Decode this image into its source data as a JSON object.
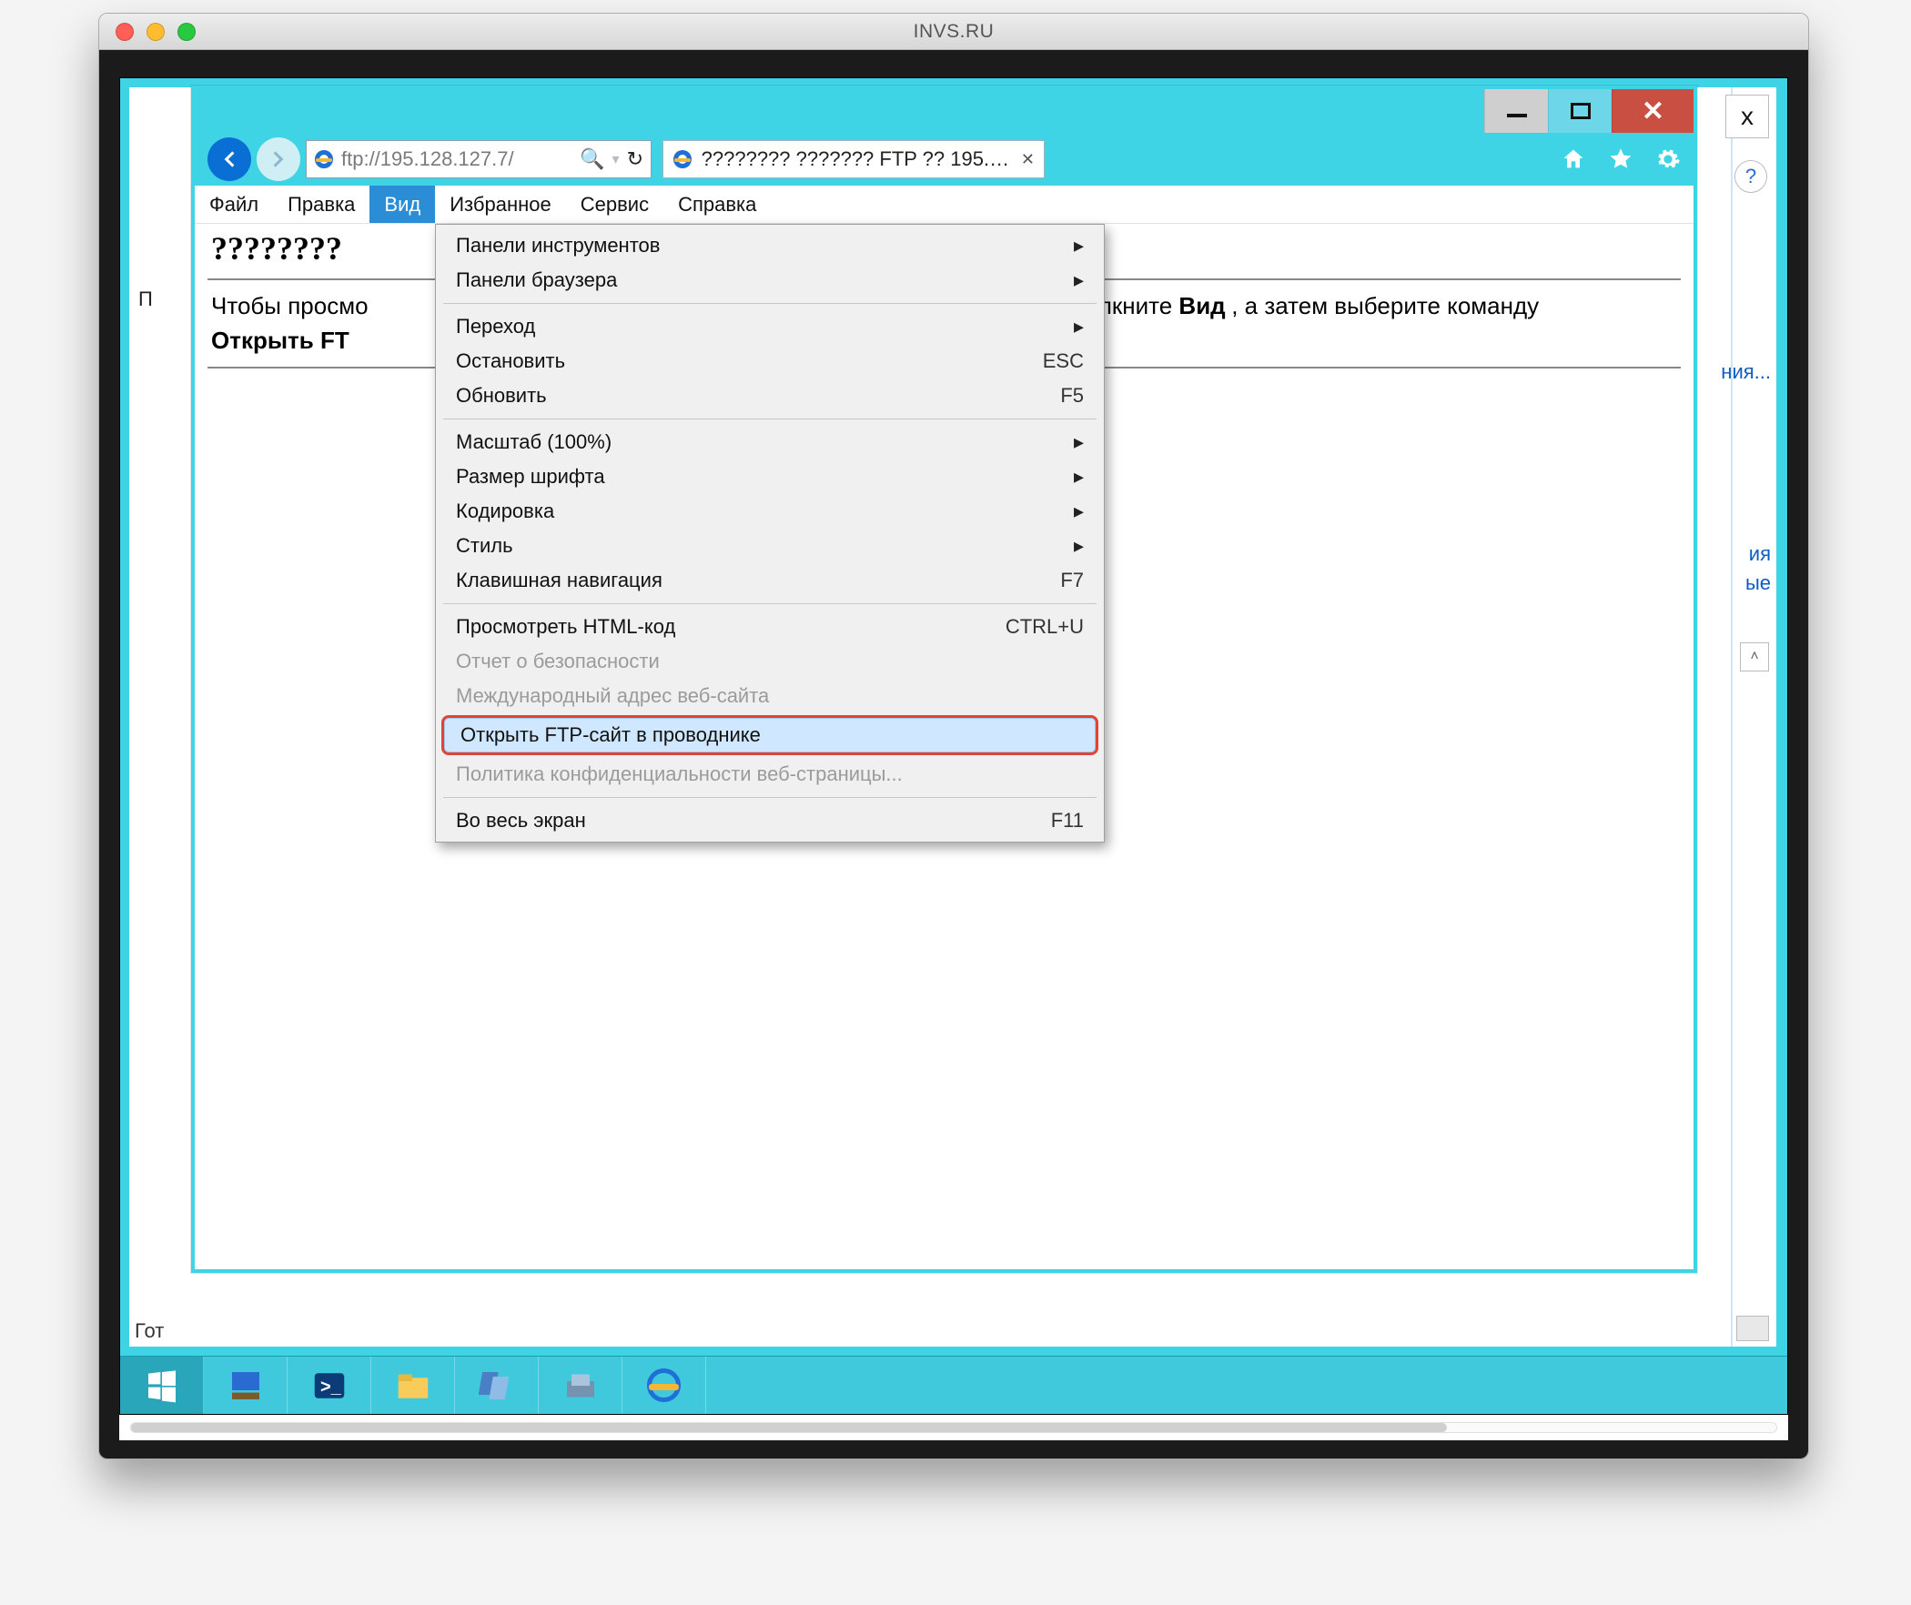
{
  "mac": {
    "title": "INVS.RU"
  },
  "bg": {
    "close_x": "x",
    "help": "?",
    "link1": "ния...",
    "link2": "ия",
    "link3": "ые",
    "status": "Гот",
    "left_label1": "П",
    "left_label2": ""
  },
  "ie": {
    "url": "ftp://195.128.127.7/",
    "tab_title": "???????? ??????? FTP ?? 195.1...",
    "menubar": [
      "Файл",
      "Правка",
      "Вид",
      "Избранное",
      "Сервис",
      "Справка"
    ],
    "active_menu_index": 2,
    "page": {
      "heading": "????????",
      "line1_pre": "Чтобы просмо",
      "line1_post": ", щелкните ",
      "line1_bold": "Вид",
      "line1_tail": ", а затем выберите команду",
      "line2_bold": "Открыть FT"
    }
  },
  "menu": {
    "items": [
      {
        "label": "Панели инструментов",
        "submenu": true
      },
      {
        "label": "Панели браузера",
        "submenu": true
      },
      {
        "sep": true
      },
      {
        "label": "Переход",
        "submenu": true
      },
      {
        "label": "Остановить",
        "shortcut": "ESC"
      },
      {
        "label": "Обновить",
        "shortcut": "F5"
      },
      {
        "sep": true
      },
      {
        "label": "Масштаб (100%)",
        "submenu": true
      },
      {
        "label": "Размер шрифта",
        "submenu": true
      },
      {
        "label": "Кодировка",
        "submenu": true
      },
      {
        "label": "Стиль",
        "submenu": true
      },
      {
        "label": "Клавишная навигация",
        "shortcut": "F7"
      },
      {
        "sep": true
      },
      {
        "label": "Просмотреть HTML-код",
        "shortcut": "CTRL+U"
      },
      {
        "label": "Отчет о безопасности",
        "disabled": true
      },
      {
        "label": "Международный адрес веб-сайта",
        "disabled": true
      },
      {
        "label": "Открыть FTP-сайт в проводнике",
        "highlight": true
      },
      {
        "label": "Политика конфиденциальности веб-страницы...",
        "disabled": true
      },
      {
        "sep": true
      },
      {
        "label": "Во весь экран",
        "shortcut": "F11"
      }
    ]
  }
}
